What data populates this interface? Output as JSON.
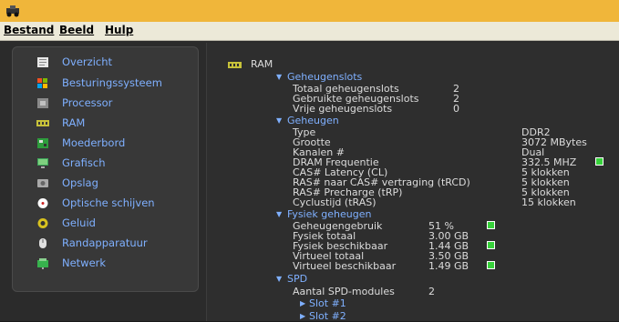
{
  "menu": [
    "Bestand",
    "Beeld",
    "Hulp"
  ],
  "sidebar": [
    {
      "label": "Overzicht",
      "icon": "overview-icon",
      "color": "#e8e8e8"
    },
    {
      "label": "Besturingssysteem",
      "icon": "windows-icon",
      "color": "#ff8c1a"
    },
    {
      "label": "Processor",
      "icon": "processor-icon",
      "color": "#8a8a8a"
    },
    {
      "label": "RAM",
      "icon": "ram-icon",
      "color": "#c7c23a"
    },
    {
      "label": "Moederbord",
      "icon": "motherboard-icon",
      "color": "#2e9d3d"
    },
    {
      "label": "Grafisch",
      "icon": "monitor-icon",
      "color": "#3da55a"
    },
    {
      "label": "Opslag",
      "icon": "disk-icon",
      "color": "#a9a9a9"
    },
    {
      "label": "Optische schijven",
      "icon": "disc-icon",
      "color": "#ffffff"
    },
    {
      "label": "Geluid",
      "icon": "speaker-icon",
      "color": "#d8c21f"
    },
    {
      "label": "Randapparatuur",
      "icon": "mouse-icon",
      "color": "#e0e0e0"
    },
    {
      "label": "Netwerk",
      "icon": "network-icon",
      "color": "#37b24d"
    }
  ],
  "content": {
    "title": "RAM",
    "slots": {
      "header": "Geheugenslots",
      "rows": [
        {
          "label": "Totaal geheugenslots",
          "value": "2"
        },
        {
          "label": "Gebruikte geheugenslots",
          "value": "2"
        },
        {
          "label": "Vrije geheugenslots",
          "value": "0"
        }
      ]
    },
    "memory": {
      "header": "Geheugen",
      "rows": [
        {
          "label": "Type",
          "value": "DDR2"
        },
        {
          "label": "Grootte",
          "value": "3072 MBytes"
        },
        {
          "label": "Kanalen #",
          "value": "Dual"
        },
        {
          "label": "DRAM Frequentie",
          "value": "332.5 MHZ"
        },
        {
          "label": "CAS# Latency (CL)",
          "value": "5 klokken"
        },
        {
          "label": "RAS# naar CAS# vertraging (tRCD)",
          "value": "5 klokken"
        },
        {
          "label": "RAS# Precharge (tRP)",
          "value": "5 klokken"
        },
        {
          "label": "Cyclustijd (tRAS)",
          "value": "15 klokken"
        }
      ]
    },
    "physical": {
      "header": "Fysiek geheugen",
      "rows": [
        {
          "label": "Geheugengebruik",
          "value": "51 %"
        },
        {
          "label": "Fysiek totaal",
          "value": "3.00 GB"
        },
        {
          "label": "Fysiek beschikbaar",
          "value": "1.44 GB"
        },
        {
          "label": "Virtueel totaal",
          "value": "3.50 GB"
        },
        {
          "label": "Virtueel beschikbaar",
          "value": "1.49 GB"
        }
      ]
    },
    "spd": {
      "header": "SPD",
      "count_label": "Aantal SPD-modules",
      "count_value": "2",
      "slots": [
        "Slot #1",
        "Slot #2"
      ]
    }
  },
  "colors": {
    "accent": "#7fb0ff",
    "status_green": "#37d23b",
    "titlebar": "#f0b63a"
  }
}
